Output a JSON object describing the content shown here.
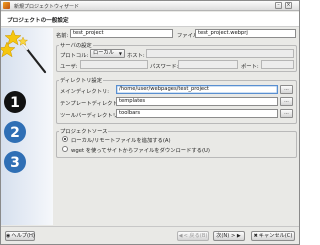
{
  "window": {
    "title": "新規プロジェクトウィザード",
    "icon": "app-icon"
  },
  "header": {
    "title": "プロジェクトの一般設定"
  },
  "sidebar": {
    "steps": [
      "1",
      "2",
      "3"
    ],
    "icons": [
      "stars-wand-icon"
    ]
  },
  "form": {
    "name_label": "名前:",
    "name_value": "test_project",
    "file_label": "ファイル:",
    "file_value": "test_project.webprj"
  },
  "server": {
    "title": "サーバの設定",
    "protocol_label": "プロトコル:",
    "protocol_value": "ローカル",
    "host_label": "ホスト:",
    "host_value": "",
    "user_label": "ユーザ:",
    "user_value": "",
    "password_label": "パスワード:",
    "password_value": "",
    "port_label": "ポート:",
    "port_value": ""
  },
  "directories": {
    "title": "ディレクトリ設定",
    "main_label": "メインディレクトリ:",
    "main_value": "/home/user/webpages/test_project",
    "template_label": "テンプレートディレクトリ:",
    "template_value": "templates",
    "toolbar_label": "ツールバーディレクトリ:",
    "toolbar_value": "toolbars",
    "browse_label": "..."
  },
  "source": {
    "title": "プロジェクトソース",
    "option1": "ローカル/リモートファイルを追加する(A)",
    "option2": "wget を使ってサイトからファイルをダウンロードする(U)",
    "selected": 1
  },
  "footer": {
    "help": "ヘルプ(H)",
    "back": "< 戻る(B)",
    "next": "次(N) >",
    "cancel": "キャンセル(C)"
  }
}
